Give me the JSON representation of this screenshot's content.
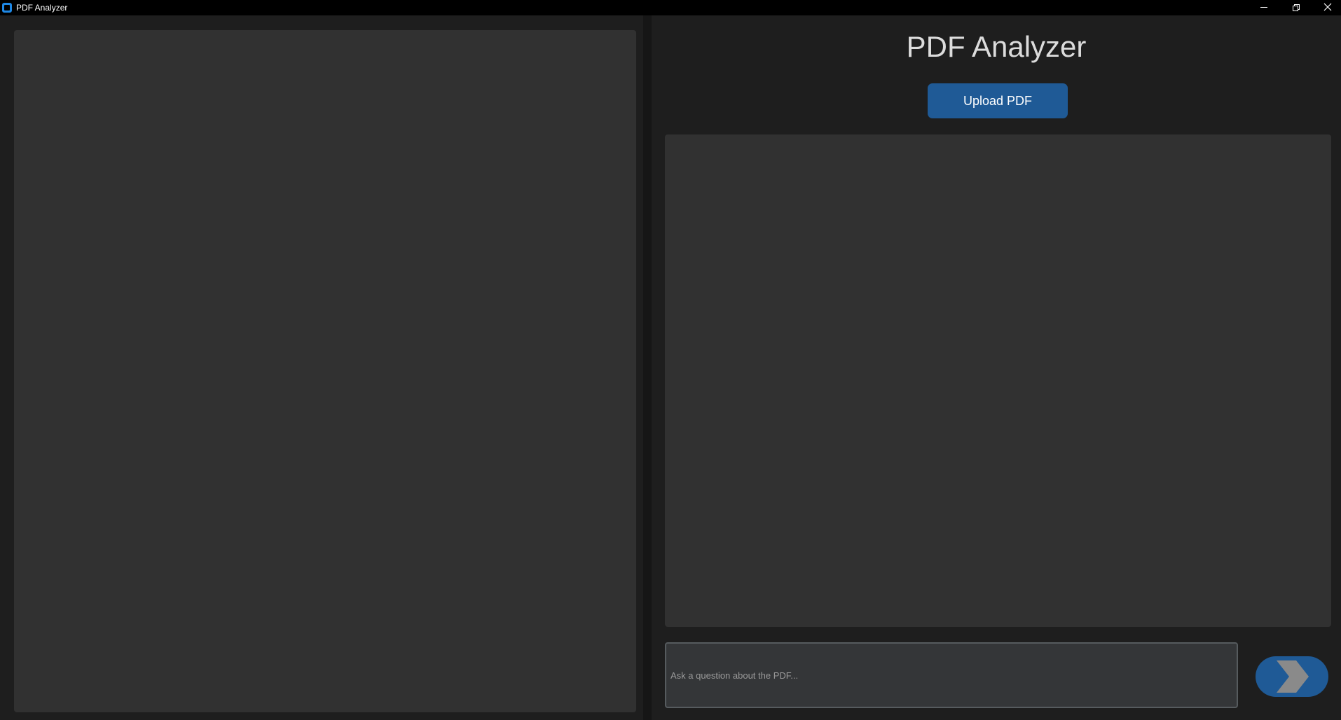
{
  "window": {
    "title": "PDF Analyzer",
    "controls": {
      "minimize_icon": "minimize-icon",
      "restore_icon": "restore-icon",
      "close_icon": "close-icon"
    }
  },
  "main": {
    "heading": "PDF Analyzer",
    "upload_label": "Upload PDF",
    "question_placeholder": "Ask a question about the PDF...",
    "question_value": "",
    "send_icon": "chevron-right-icon"
  },
  "colors": {
    "accent": "#1f5a96",
    "panel": "#313131",
    "background": "#1e1e1e"
  }
}
